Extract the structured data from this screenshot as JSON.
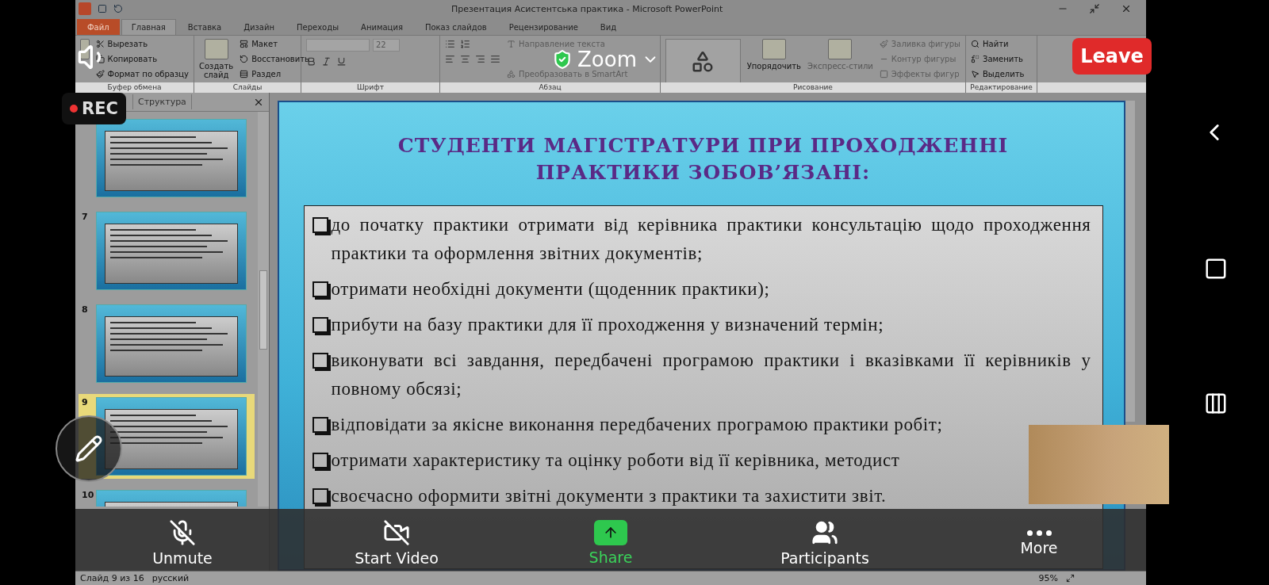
{
  "window": {
    "title": "Презентация Асистентська практика - Microsoft PowerPoint"
  },
  "ribbon": {
    "tabs": [
      {
        "label": "Файл",
        "selected": false,
        "kind": "file"
      },
      {
        "label": "Главная",
        "selected": true,
        "kind": "tab"
      },
      {
        "label": "Вставка",
        "selected": false,
        "kind": "tab"
      },
      {
        "label": "Дизайн",
        "selected": false,
        "kind": "tab"
      },
      {
        "label": "Переходы",
        "selected": false,
        "kind": "tab"
      },
      {
        "label": "Анимация",
        "selected": false,
        "kind": "tab"
      },
      {
        "label": "Показ слайдов",
        "selected": false,
        "kind": "tab"
      },
      {
        "label": "Рецензирование",
        "selected": false,
        "kind": "tab"
      },
      {
        "label": "Вид",
        "selected": false,
        "kind": "tab"
      }
    ],
    "groups": [
      {
        "kind": "clipboard",
        "label": "Буфер обмена",
        "items": [
          {
            "label": "Вырезать",
            "disabled": false
          },
          {
            "label": "Копировать",
            "disabled": false
          },
          {
            "label": "Формат по образцу",
            "disabled": false
          }
        ]
      },
      {
        "kind": "slides",
        "label": "Слайды",
        "large": "Создать слайд",
        "items": [
          {
            "label": "Макет",
            "disabled": false
          },
          {
            "label": "Восстановить",
            "disabled": false
          },
          {
            "label": "Раздел",
            "disabled": false
          }
        ]
      },
      {
        "kind": "font",
        "label": "Шрифт",
        "field": "22"
      },
      {
        "kind": "paragraph",
        "label": "Абзац",
        "items": [
          {
            "label": "Направление текста",
            "disabled": true
          },
          {
            "label": "Преобразовать в SmartArt",
            "disabled": true
          }
        ]
      },
      {
        "kind": "drawing",
        "label": "Рисование",
        "large": "Упорядочить",
        "large2": "Экспресс-стили",
        "items": [
          {
            "label": "Заливка фигуры",
            "disabled": true
          },
          {
            "label": "Контур фигуры",
            "disabled": true
          },
          {
            "label": "Эффекты фигур",
            "disabled": true
          }
        ]
      },
      {
        "kind": "editing",
        "label": "Редактирование",
        "items": [
          {
            "label": "Найти",
            "disabled": false
          },
          {
            "label": "Заменить",
            "disabled": false
          },
          {
            "label": "Выделить",
            "disabled": false
          }
        ]
      }
    ]
  },
  "slide_panel": {
    "tabs": [
      {
        "label": "Структура",
        "selected": false
      }
    ],
    "thumbnails": [
      {
        "selected": false
      },
      {
        "number": "7",
        "selected": false
      },
      {
        "number": "8",
        "selected": false
      },
      {
        "number": "9",
        "selected": true
      },
      {
        "number": "10",
        "selected": false
      }
    ]
  },
  "slide": {
    "title": "СТУДЕНТИ МАГІСТРАТУРИ ПРИ ПРОХОДЖЕННІ ПРАКТИКИ ЗОБОВ’ЯЗАНІ:",
    "bullets": [
      "до початку практики отримати від керівника практики консультацію щодо проходження практики та оформлення звітних документів;",
      " отримати необхідні документи (щоденник практики);",
      "прибути на базу практики для її проходження у визначений термін;",
      "виконувати всі завдання, передбачені програмою практики і вказівками її керівників у повному обсязі;",
      "відповідати за якісне виконання передбачених програмою практики робіт;",
      "отримати характеристику та оцінку роботи від її керівника, методист",
      "своєчасно оформити звітні документи з практики та захистити звіт."
    ]
  },
  "status_bar": {
    "slide_info": "Слайд 9 из 16",
    "language": "русский",
    "zoom": "95%"
  },
  "zoom": {
    "title": "Zoom",
    "leave": "Leave",
    "rec": "REC",
    "toolbar": [
      {
        "kind": "mic",
        "label": "Unmute"
      },
      {
        "kind": "video",
        "label": "Start Video"
      },
      {
        "kind": "share",
        "label": "Share"
      },
      {
        "kind": "participants",
        "label": "Participants"
      },
      {
        "kind": "more",
        "label": "More"
      }
    ]
  }
}
